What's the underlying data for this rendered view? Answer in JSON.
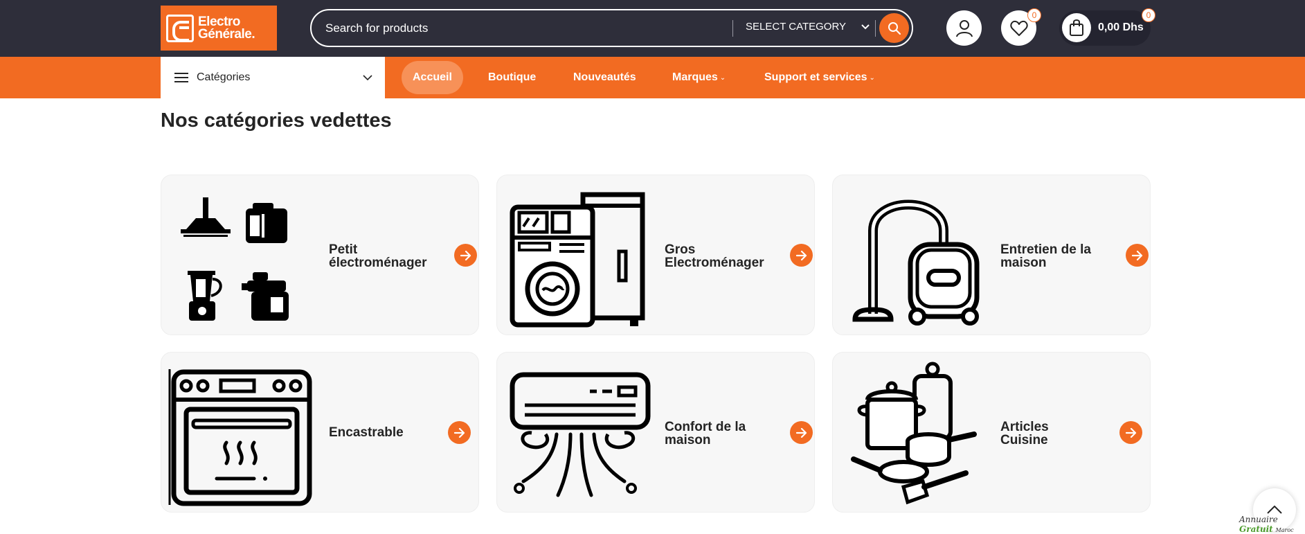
{
  "brand": {
    "logo_line1": "Electro",
    "logo_line2": "Générale.",
    "accent": "#f26b22",
    "dark": "#2e2e3a"
  },
  "search": {
    "placeholder": "Search for products",
    "category_label": "SELECT CATEGORY"
  },
  "header": {
    "wishlist_count": "0",
    "cart_count": "0",
    "cart_total": "0,00 Dhs"
  },
  "nav": {
    "categories_label": "Catégories",
    "items": [
      {
        "label": "Accueil",
        "active": true
      },
      {
        "label": "Boutique"
      },
      {
        "label": "Nouveautés"
      },
      {
        "label": "Marques",
        "has_dropdown": true
      },
      {
        "label": "Support et services",
        "has_dropdown": true
      }
    ]
  },
  "main": {
    "title": "Nos catégories vedettes",
    "categories": [
      {
        "line1": "Petit",
        "line2": "électroménager",
        "icon": "small-appliances-icon"
      },
      {
        "line1": "Gros",
        "line2": "Electroménager",
        "icon": "large-appliances-icon"
      },
      {
        "line1": "Entretien de la",
        "line2": "maison",
        "icon": "vacuum-cleaner-icon"
      },
      {
        "line1": "Encastrable",
        "line2": "",
        "icon": "oven-icon"
      },
      {
        "line1": "Confort de la",
        "line2": "maison",
        "icon": "air-conditioner-icon"
      },
      {
        "line1": "Articles",
        "line2": "Cuisine",
        "icon": "cookware-icon"
      }
    ]
  },
  "footer": {
    "watermark_a": "Annuaire",
    "watermark_b": "Gratuit",
    "watermark_c": "Maroc"
  }
}
